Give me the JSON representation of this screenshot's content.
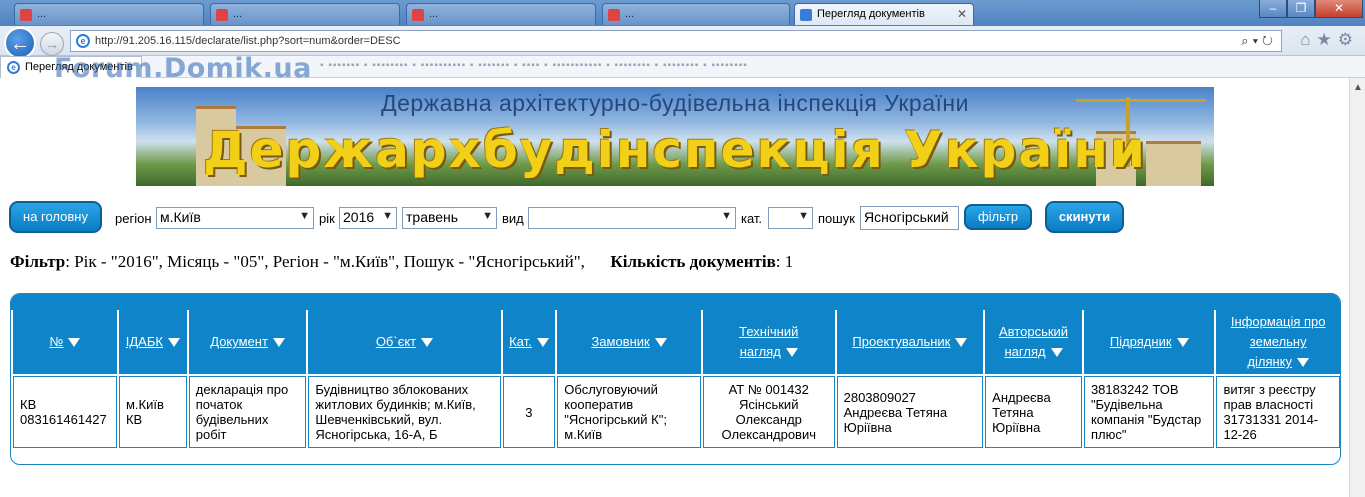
{
  "browser": {
    "tabs": [
      {
        "label": "..."
      },
      {
        "label": "..."
      },
      {
        "label": "..."
      },
      {
        "label": "..."
      },
      {
        "label": "Перегляд документів"
      }
    ],
    "address": "http://91.205.16.115/declarate/list.php?sort=num&order=DESC",
    "current_tab": "Перегляд документів",
    "watermark": "Forum.Domik.ua"
  },
  "banner": {
    "line1": "Державна архітектурно-будівельна інспекція України",
    "line2": "Держархбудінспекція України"
  },
  "controls": {
    "home_button": "на головну",
    "region_label": "регіон",
    "region_value": "м.Київ",
    "year_label": "рік",
    "year_value": "2016",
    "month_value": "травень",
    "type_label": "вид",
    "type_value": "",
    "cat_label": "кат.",
    "cat_value": "",
    "search_label": "пошук",
    "search_value": "Ясногірський",
    "filter_button": "фільтр",
    "reset_button": "скинути"
  },
  "filter_summary": {
    "filter_label": "Фільтр",
    "filter_text": ": Рік - \"2016\", Місяць - \"05\", Регіон - \"м.Київ\", Пошук - \"Ясногірський\",",
    "count_label": "Кількість документів",
    "count_text": ": 1"
  },
  "table": {
    "headers": [
      {
        "l1": "№"
      },
      {
        "l1": "ІДАБК"
      },
      {
        "l1": "Документ"
      },
      {
        "l1": "Об`єкт"
      },
      {
        "l1": "Кат."
      },
      {
        "l1": "Замовник"
      },
      {
        "l1": "Технічний",
        "l2": "нагляд"
      },
      {
        "l1": "Проектувальник"
      },
      {
        "l1": "Авторський",
        "l2": "нагляд"
      },
      {
        "l1": "Підрядник"
      },
      {
        "l1": "Інформація про",
        "l2": "земельну",
        "l3": "ділянку"
      }
    ],
    "rows": [
      {
        "num": "КВ 083161461427",
        "idabk": "м.Київ КВ",
        "document": "декларація про початок будівельних робіт",
        "object": "Будівництво зблокованих житлових будинків; м.Київ, Шевченківський, вул. Ясногірська, 16-А, Б",
        "cat": "3",
        "customer": "Обслуговуючий кооператив \"Ясногірський К\"; м.Київ",
        "tech_supervision": "АТ № 001432 Ясінський Олександр Олександрович",
        "designer": "2803809027 Андреєва Тетяна Юріївна",
        "author_supervision": "Андреєва Тетяна Юріївна",
        "contractor": "38183242 ТОВ \"Будівельна компанія \"Будстар плюс\"",
        "land_info": "витяг з реєстру прав власності 31731331 2014-12-26"
      }
    ]
  }
}
